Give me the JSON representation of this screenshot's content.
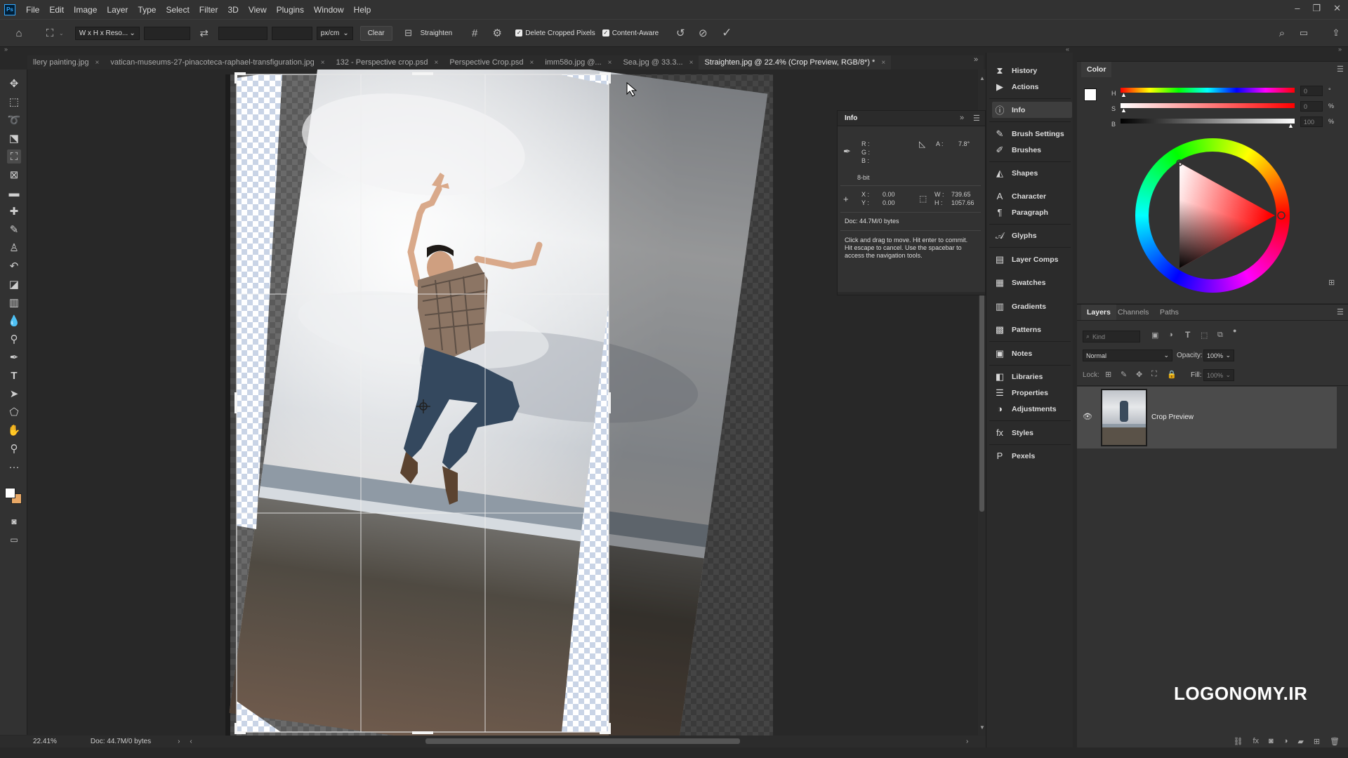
{
  "menubar": {
    "logo": "Ps",
    "items": [
      "File",
      "Edit",
      "Image",
      "Layer",
      "Type",
      "Select",
      "Filter",
      "3D",
      "View",
      "Plugins",
      "Window",
      "Help"
    ]
  },
  "options_bar": {
    "ratio_preset": "W x H x Reso...",
    "units": "px/cm",
    "clear_label": "Clear",
    "straighten_label": "Straighten",
    "delete_cropped_label": "Delete Cropped Pixels",
    "delete_cropped_checked": true,
    "content_aware_label": "Content-Aware",
    "content_aware_checked": true
  },
  "tabs": [
    {
      "label": "llery painting.jpg",
      "active": false
    },
    {
      "label": "vatican-museums-27-pinacoteca-raphael-transfiguration.jpg",
      "active": false
    },
    {
      "label": "132 - Perspective crop.psd",
      "active": false
    },
    {
      "label": "Perspective Crop.psd",
      "active": false
    },
    {
      "label": "imm58o.jpg @...",
      "active": false
    },
    {
      "label": "Sea.jpg @ 33.3...",
      "active": false
    },
    {
      "label": "Straighten.jpg @ 22.4% (Crop Preview, RGB/8*) *",
      "active": true
    }
  ],
  "info_panel": {
    "title": "Info",
    "r_label": "R :",
    "g_label": "G :",
    "b_label": "B :",
    "bit_depth": "8-bit",
    "angle_label": "A :",
    "angle_value": "7.8°",
    "x_label": "X :",
    "x_value": "0.00",
    "y_label": "Y :",
    "y_value": "0.00",
    "w_label": "W :",
    "w_value": "739.65",
    "h_label": "H :",
    "h_value": "1057.66",
    "doc": "Doc: 44.7M/0 bytes",
    "hint": "Click and drag to move. Hit enter to commit. Hit escape to cancel. Use the spacebar to access the navigation tools."
  },
  "dock": [
    {
      "label": "History",
      "icon": "history-icon",
      "glyph": "⧗",
      "selected": false
    },
    {
      "label": "Actions",
      "icon": "play-icon",
      "glyph": "▶",
      "selected": false
    },
    {
      "label": "Info",
      "icon": "info-icon",
      "glyph": "ⓘ",
      "selected": true
    },
    {
      "label": "Brush Settings",
      "icon": "brush-settings-icon",
      "glyph": "✎",
      "selected": false
    },
    {
      "label": "Brushes",
      "icon": "brushes-icon",
      "glyph": "✐",
      "selected": false
    },
    {
      "label": "Shapes",
      "icon": "shapes-icon",
      "glyph": "◭",
      "selected": false
    },
    {
      "label": "Character",
      "icon": "character-icon",
      "glyph": "A",
      "selected": false
    },
    {
      "label": "Paragraph",
      "icon": "paragraph-icon",
      "glyph": "¶",
      "selected": false
    },
    {
      "label": "Glyphs",
      "icon": "glyphs-icon",
      "glyph": "𝒜",
      "selected": false
    },
    {
      "label": "Layer Comps",
      "icon": "layer-comps-icon",
      "glyph": "▤",
      "selected": false
    },
    {
      "label": "Swatches",
      "icon": "swatches-icon",
      "glyph": "▦",
      "selected": false
    },
    {
      "label": "Gradients",
      "icon": "gradients-icon",
      "glyph": "▥",
      "selected": false
    },
    {
      "label": "Patterns",
      "icon": "patterns-icon",
      "glyph": "▩",
      "selected": false
    },
    {
      "label": "Notes",
      "icon": "notes-icon",
      "glyph": "▣",
      "selected": false
    },
    {
      "label": "Libraries",
      "icon": "libraries-icon",
      "glyph": "◧",
      "selected": false
    },
    {
      "label": "Properties",
      "icon": "properties-icon",
      "glyph": "☰",
      "selected": false
    },
    {
      "label": "Adjustments",
      "icon": "adjustments-icon",
      "glyph": "◑",
      "selected": false
    },
    {
      "label": "Styles",
      "icon": "styles-icon",
      "glyph": "fx",
      "selected": false
    },
    {
      "label": "Pexels",
      "icon": "pexels-icon",
      "glyph": "P",
      "selected": false
    }
  ],
  "color_panel": {
    "title": "Color",
    "h_label": "H",
    "h_value": "0",
    "s_label": "S",
    "s_value": "0",
    "b_label": "B",
    "b_value": "100",
    "pct": "%",
    "deg": "°"
  },
  "layers_panel": {
    "tabs": [
      "Layers",
      "Channels",
      "Paths"
    ],
    "kind_placeholder": "Kind",
    "blend_mode": "Normal",
    "opacity_label": "Opacity:",
    "opacity_value": "100%",
    "lock_label": "Lock:",
    "fill_label": "Fill:",
    "fill_value": "100%",
    "layer_name": "Crop Preview"
  },
  "status": {
    "zoom": "22.41%",
    "doc": "Doc: 44.7M/0 bytes"
  },
  "watermark": "LOGONOMY.IR",
  "colors": {
    "accent": "#31a8ff",
    "panel": "#323232",
    "background": "#282828"
  }
}
